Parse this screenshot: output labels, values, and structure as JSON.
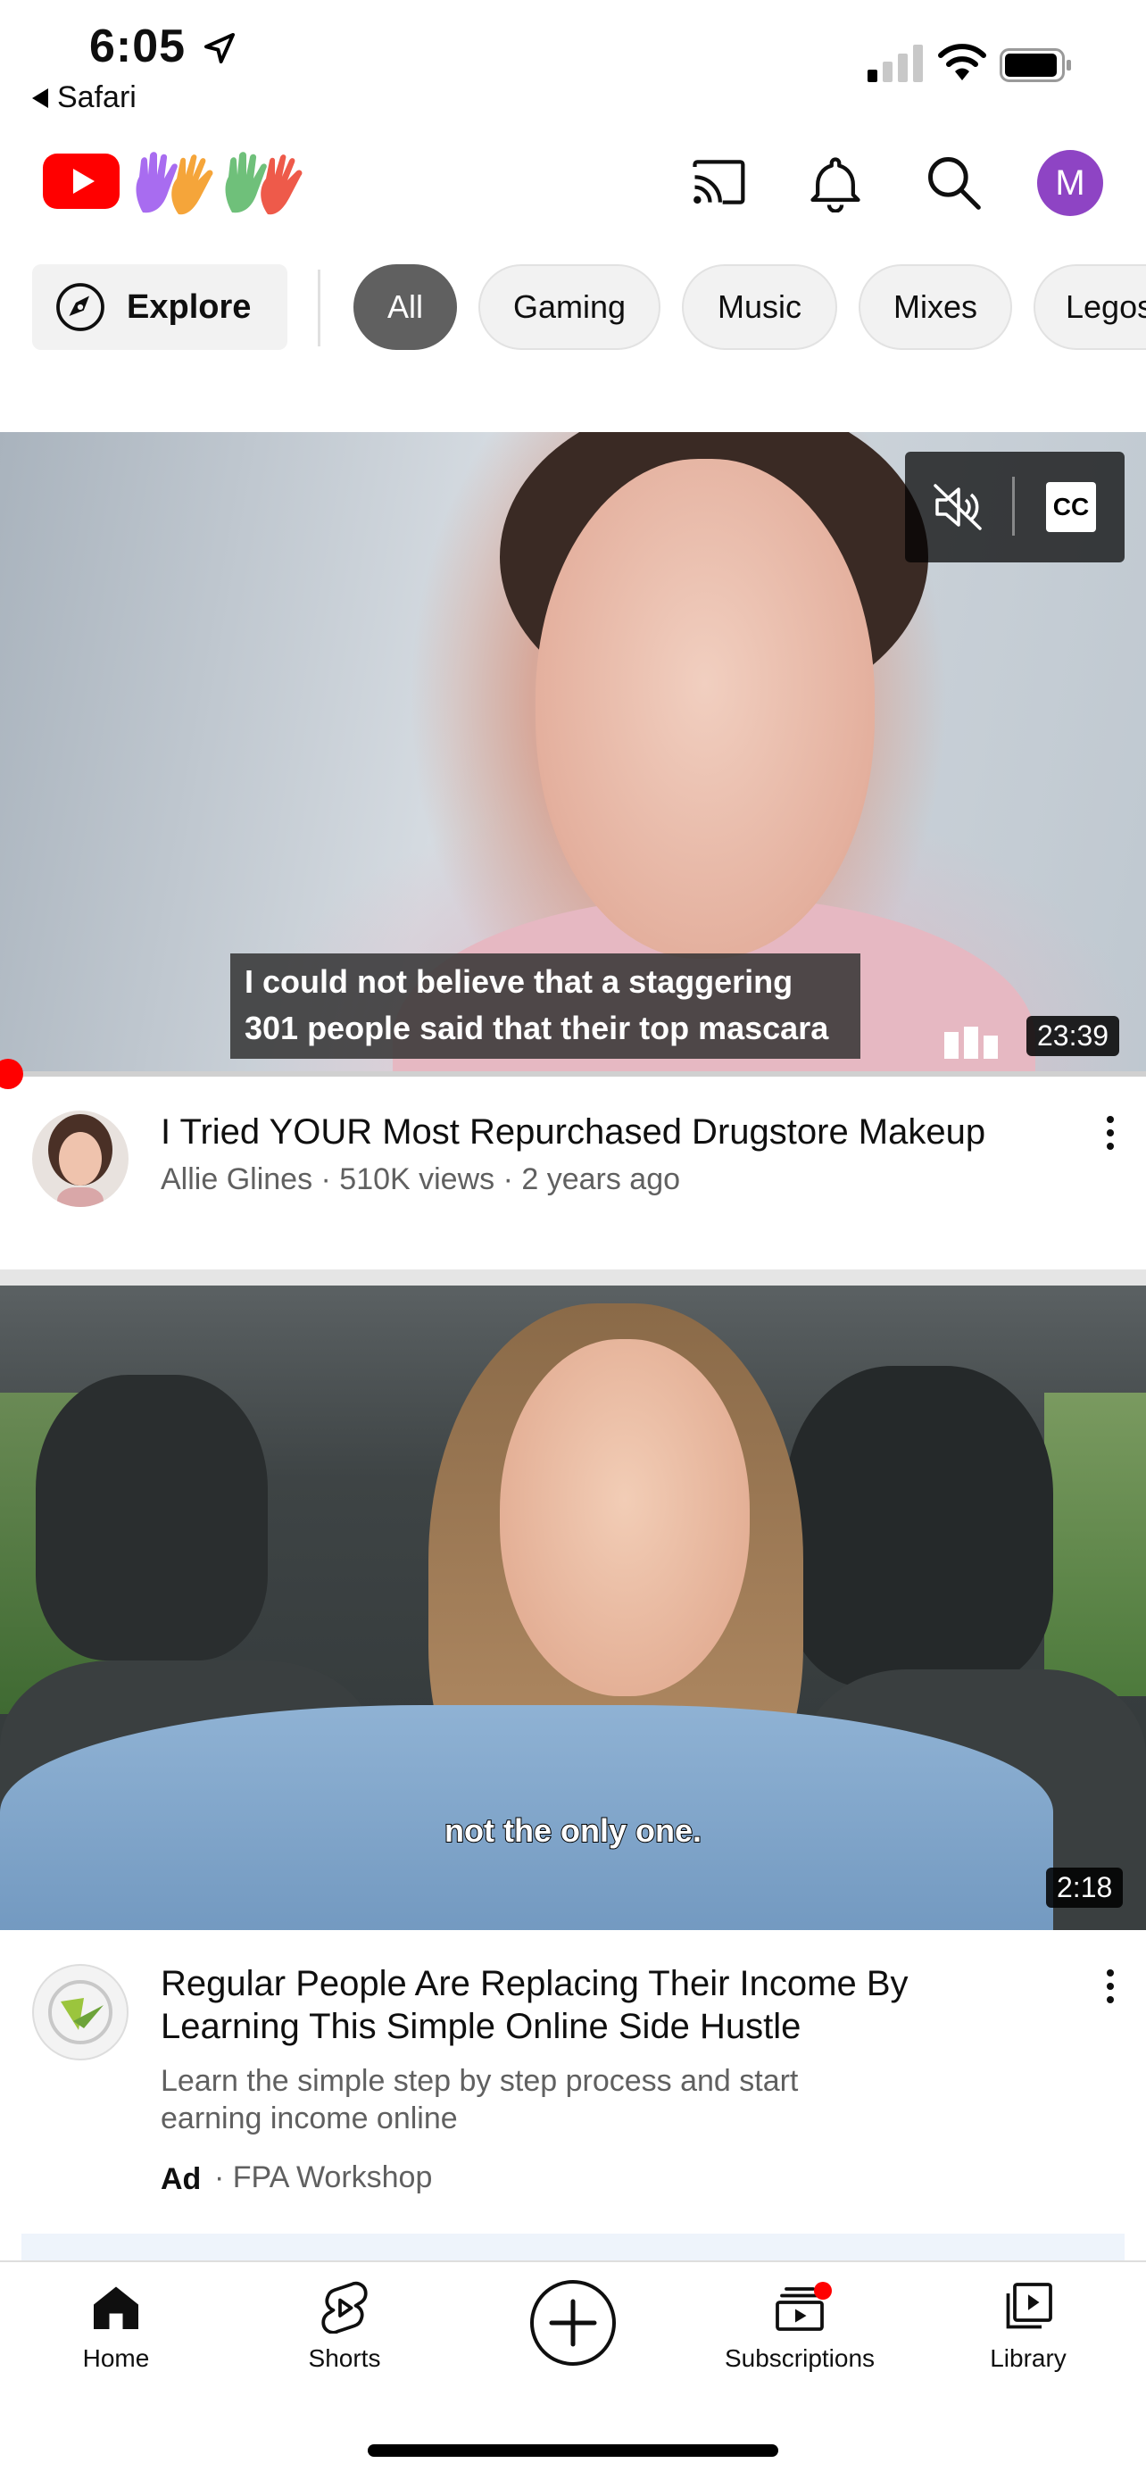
{
  "status_bar": {
    "time": "6:05",
    "back_app": "Safari"
  },
  "header": {
    "avatar_initial": "M",
    "icons": [
      "cast-icon",
      "notifications-bell-icon",
      "search-icon"
    ]
  },
  "chips": {
    "explore_label": "Explore",
    "items": [
      "All",
      "Gaming",
      "Music",
      "Mixes",
      "Legos"
    ],
    "selected": "All"
  },
  "video1": {
    "caption_line1": "I could not believe that a staggering",
    "caption_line2": "301 people said that their top mascara",
    "duration": "23:39",
    "cc_label": "CC",
    "title": "I Tried YOUR Most Repurchased Drugstore Makeup",
    "meta": "Allie Glines · 510K views · 2 years ago",
    "progress": 0.0
  },
  "video2": {
    "caption": "not the only one.",
    "duration": "2:18",
    "title_line1": "Regular People Are Replacing Their Income By",
    "title_line2": "Learning This Simple Online Side Hustle",
    "desc_line1": "Learn the simple step by step process and start",
    "desc_line2": "earning income online",
    "ad_label": "Ad",
    "ad_source": "· FPA Workshop"
  },
  "bottom_nav": {
    "home": "Home",
    "shorts": "Shorts",
    "subscriptions": "Subscriptions",
    "library": "Library"
  },
  "colors": {
    "youtube_red": "#ff0000",
    "chip_active": "#606060",
    "avatar_purple": "#8e44c4"
  }
}
